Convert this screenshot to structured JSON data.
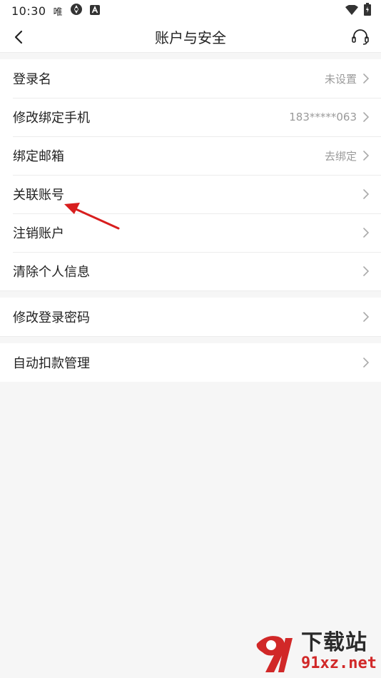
{
  "status_bar": {
    "time": "10:30",
    "app_glyph": "唯",
    "icons": [
      "unknown-app-icon",
      "a-badge-icon",
      "wifi-icon",
      "battery-icon"
    ]
  },
  "header": {
    "title": "账户与安全",
    "back_icon": "chevron-left-icon",
    "service_icon": "headset-icon"
  },
  "groups": [
    {
      "rows": [
        {
          "label": "登录名",
          "value": "未设置"
        },
        {
          "label": "修改绑定手机",
          "value": "183*****063"
        },
        {
          "label": "绑定邮箱",
          "value": "去绑定"
        },
        {
          "label": "关联账号",
          "value": ""
        },
        {
          "label": "注销账户",
          "value": ""
        },
        {
          "label": "清除个人信息",
          "value": ""
        }
      ]
    },
    {
      "rows": [
        {
          "label": "修改登录密码",
          "value": ""
        }
      ]
    },
    {
      "rows": [
        {
          "label": "自动扣款管理",
          "value": ""
        }
      ]
    }
  ],
  "annotation": {
    "color": "#d81e1e"
  },
  "watermark": {
    "title": "下载站",
    "url": "91xz.net",
    "brand_color": "#d12828"
  }
}
